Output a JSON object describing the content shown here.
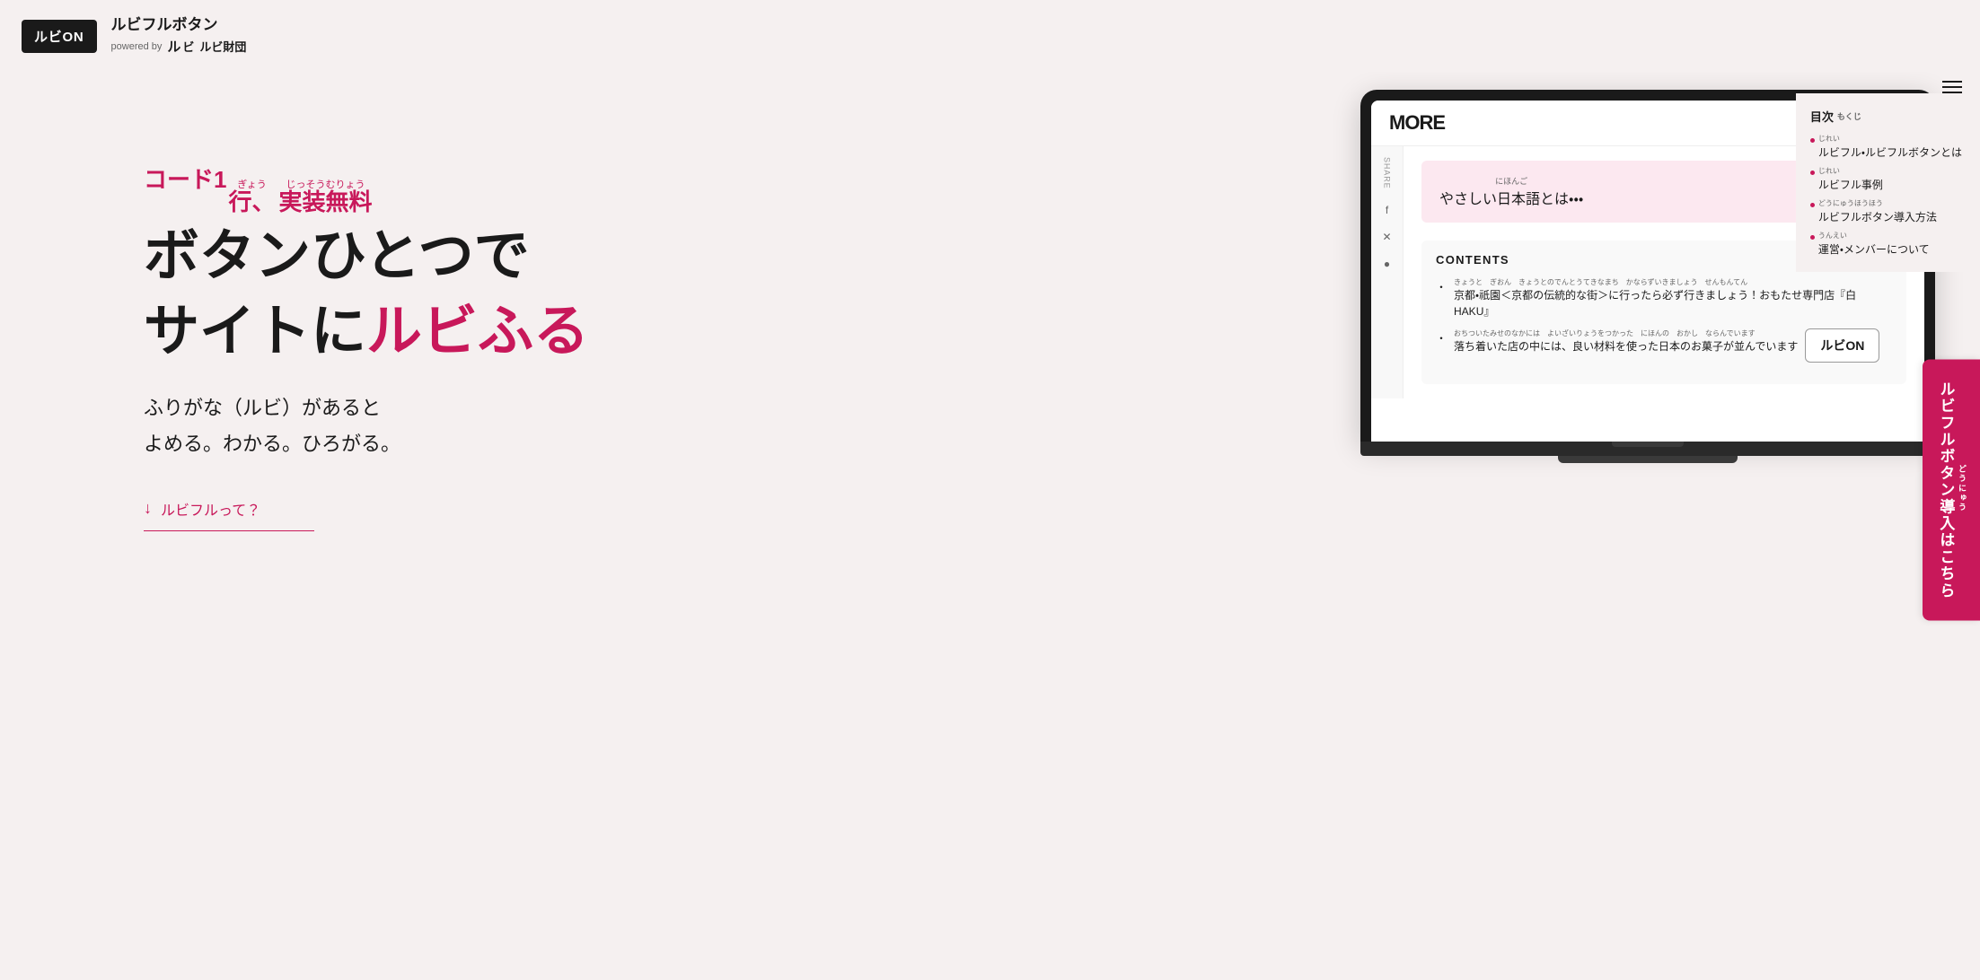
{
  "header": {
    "logo_btn_label": "ルビON",
    "brand_title": "ルビフルボタン",
    "powered_by": "powered by",
    "powered_logo1": "ルビ",
    "powered_logo2": "ルビ財団"
  },
  "toc": {
    "icon_label": "iii",
    "title": "目次",
    "title_ruby": "もくじ",
    "items": [
      {
        "text": "ルビフル・ルビフルボタンとは",
        "ruby": "じれい"
      },
      {
        "text": "ルビフル事例",
        "ruby": "じれい"
      },
      {
        "text": "ルビフルボタン導入方法",
        "ruby": "どうにゅうほうほう"
      },
      {
        "text": "運営・メンバーについて",
        "ruby": "うんえい"
      }
    ]
  },
  "cta_side": {
    "label": "ルビフルボタン導入はこちら",
    "ruby": "どうにゅう"
  },
  "hero": {
    "subtitle": "コード1行、実装無料",
    "subtitle_ruby1": "ぎょう",
    "subtitle_ruby2": "じっそうむりょう",
    "title_line1": "ボタンひとつで",
    "title_line2_prefix": "サイトに",
    "title_line2_highlight": "ルビふる",
    "desc_line1": "ふりがな（ルビ）があると",
    "desc_line2": "よめる。わかる。ひろがる。",
    "link_text": "ルビフルって？"
  },
  "laptop": {
    "screen_logo": "MORE",
    "screen_icons": [
      "f",
      "𝕏",
      "⊙",
      "♡",
      "≡"
    ],
    "sidebar_label": "SHARE",
    "sidebar_icons": [
      "f",
      "✕",
      "●"
    ],
    "pink_banner": {
      "ruby": "にほんご",
      "text": "やさしい日本語とは・・・",
      "arrow": "→"
    },
    "contents_title": "CONTENTS",
    "contents_items": [
      {
        "ruby": "きょうと　ぎおん　きょうとのでんとうてきなまち　かならずいきましょう　せんもんてん",
        "text": "京都・祇園＜京都の伝統的な街＞に行ったら必ず行きましょう！おもたせ専門店『白 HAKU』"
      },
      {
        "ruby": "おちついたみせのなかには　よいざいりょうをつかった　にほんの　おかし　ならんでいます",
        "text": "落ち着いた店の中には、良い材料を使った日本のお菓子が並んでいます"
      }
    ],
    "ruby_on_btn": "ルビON"
  }
}
